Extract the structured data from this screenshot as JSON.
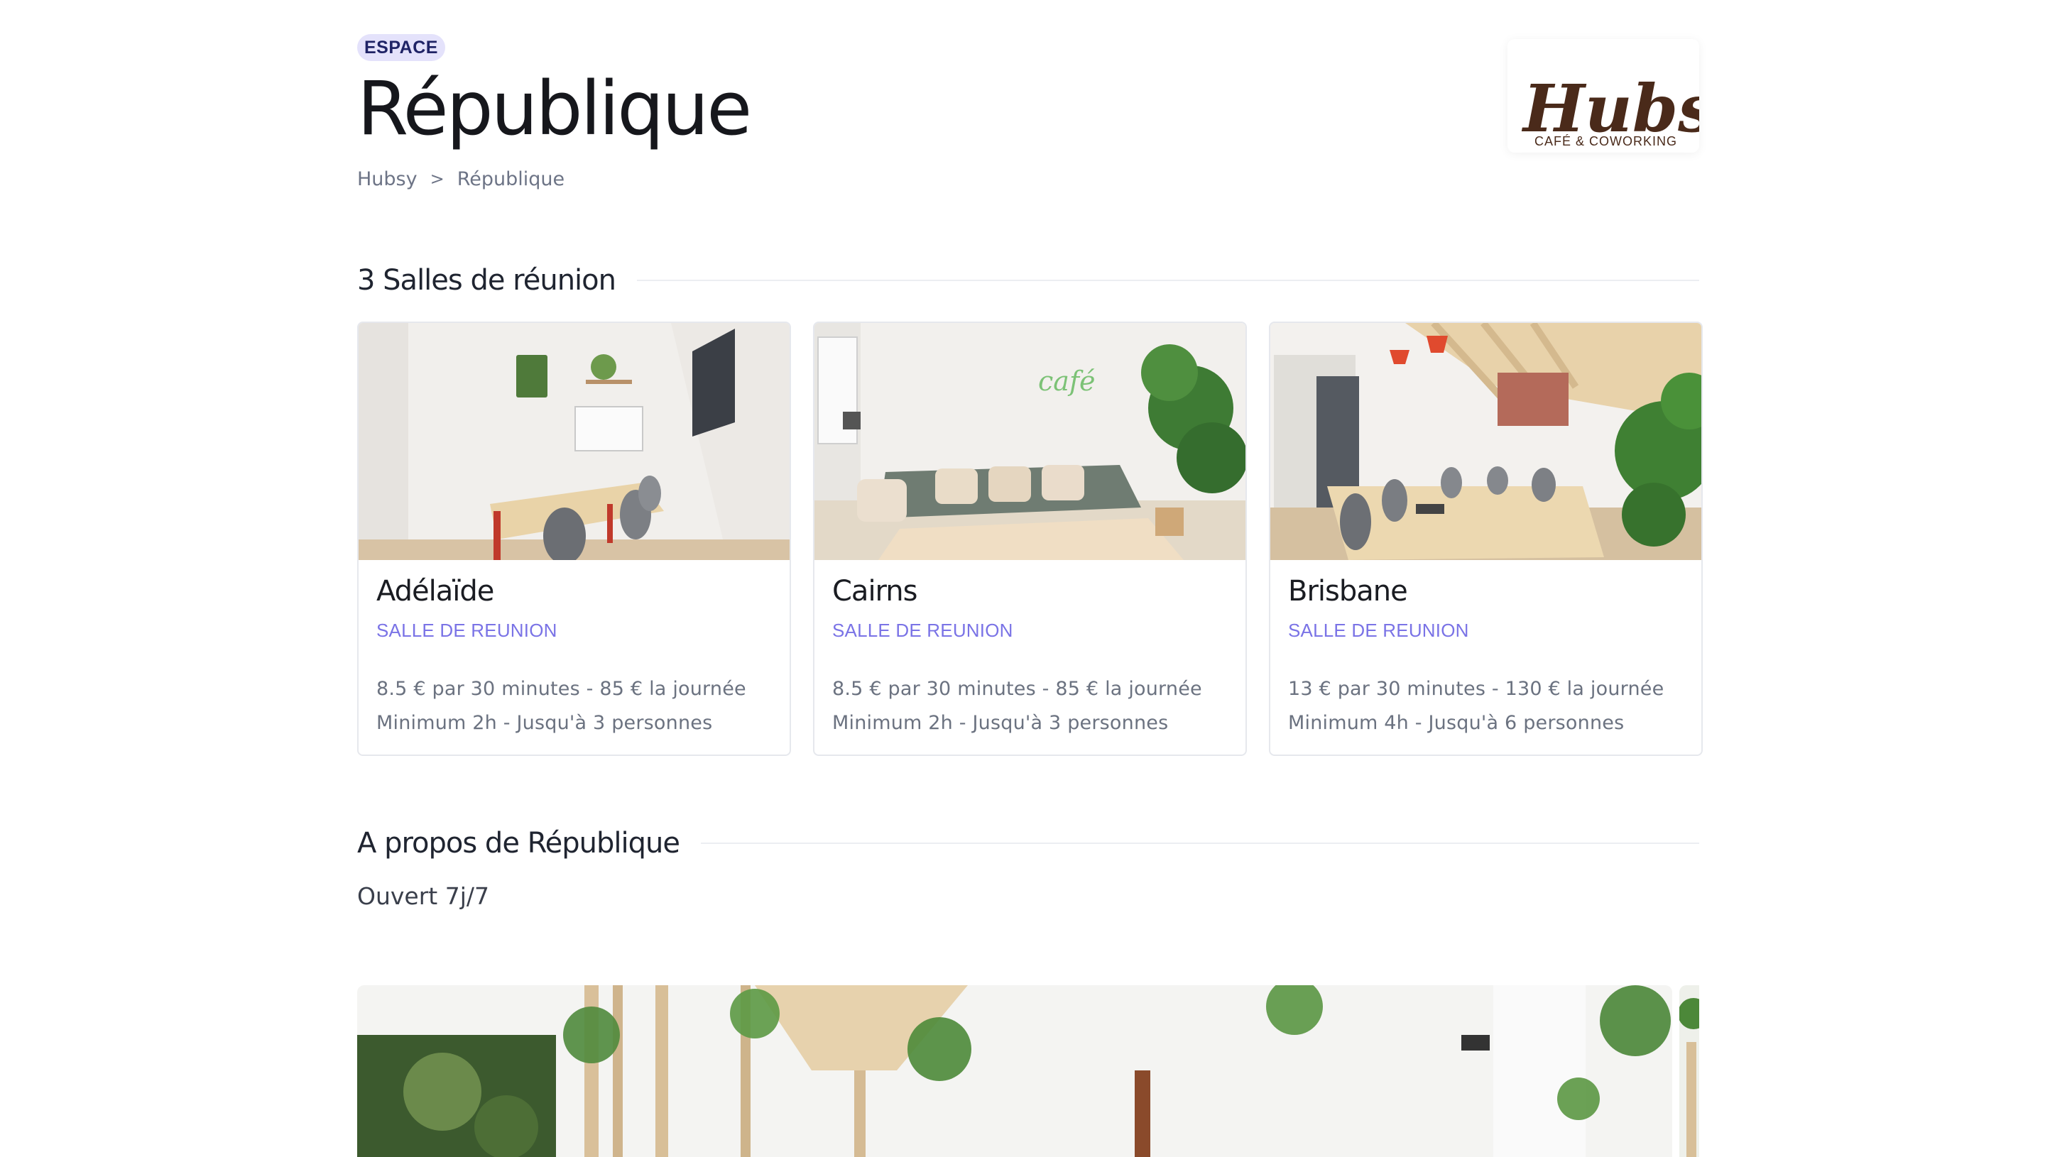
{
  "header": {
    "badge": "ESPACE",
    "title": "République",
    "breadcrumb": {
      "home": "Hubsy",
      "separator": ">",
      "current": "République"
    },
    "logo": {
      "brand": "Hubsy",
      "tagline": "CAFÉ & COWORKING"
    }
  },
  "rooms_section": {
    "heading": "3 Salles de réunion",
    "rooms": [
      {
        "name": "Adélaïde",
        "type": "SALLE DE REUNION",
        "pricing": "8.5 € par 30 minutes - 85 € la journée",
        "conditions": "Minimum 2h - Jusqu'à 3 personnes"
      },
      {
        "name": "Cairns",
        "type": "SALLE DE REUNION",
        "pricing": "8.5 € par 30 minutes - 85 € la journée",
        "conditions": "Minimum 2h - Jusqu'à 3 personnes"
      },
      {
        "name": "Brisbane",
        "type": "SALLE DE REUNION",
        "pricing": "13 € par 30 minutes - 130 € la journée",
        "conditions": "Minimum 4h - Jusqu'à 6 personnes"
      }
    ]
  },
  "about_section": {
    "heading": "A propos de République",
    "text": "Ouvert 7j/7"
  },
  "colors": {
    "accent": "#7a73e6",
    "badge_bg": "#e4e2fb",
    "logo_brown": "#4a2a1a"
  },
  "icons": {
    "breadcrumb_separator": "chevron-right-icon"
  }
}
